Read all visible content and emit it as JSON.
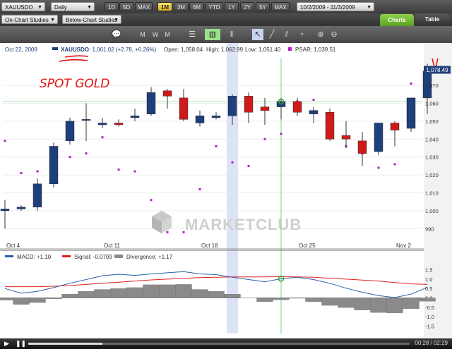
{
  "toolbar": {
    "symbol": "XAUUSDO",
    "interval": "Daily",
    "periods": [
      "1D",
      "5D",
      "MAX",
      "1M",
      "3M",
      "6M",
      "YTD",
      "1Y",
      "2Y",
      "5Y",
      "MAX"
    ],
    "active_period": "1M",
    "date_range": "10/2/2009 - 11/3/2009",
    "on_chart_studies": "On-Chart Studies",
    "below_chart_studies": "Below-Chart Studies",
    "tab_charts": "Charts",
    "tab_table": "Table"
  },
  "info_bar": {
    "date": "Oct 22, 2009",
    "symbol_label": "XAUUSDO",
    "quote": ": 1,061.02 (+2.78, +0.26%)",
    "open": "Open: 1,058.04",
    "high": "High: 1,062.99",
    "low": "Low: 1,051.40",
    "psar": "PSAR: 1,039.51"
  },
  "annotation_text": "SPOT GOLD",
  "price_tag": "1,078.49",
  "watermark": "MARKETCLUB",
  "x_labels": [
    "Oct 4",
    "Oct 11",
    "Oct 18",
    "Oct 25",
    "Nov 2"
  ],
  "indicator_legend": {
    "macd": "MACD: +1.10",
    "signal": "Signal: -0.0709",
    "divergence": "Divergence: +1.17"
  },
  "player": {
    "time": "00:28 / 02:29"
  },
  "colors": {
    "up": "#1e3f7a",
    "down": "#cc1b1b",
    "psar": "#b21cc8",
    "macd": "#2a5fa8",
    "signal": "#e02020",
    "divergence": "#8a8a8a",
    "highlight": "#dde3f6",
    "crosshair": "#7ed07e"
  },
  "chart_data": [
    {
      "type": "candlestick",
      "title": "",
      "ylim": [
        985,
        1085
      ],
      "yticks": [
        990,
        1000,
        1010,
        1020,
        1030,
        1040,
        1050,
        1060,
        1070
      ],
      "ytick_labels": [
        "990",
        "1,000",
        "1,010",
        "1,020",
        "1,030",
        "1,040",
        "1,050",
        "1,060",
        "1,070"
      ],
      "candles": [
        {
          "o": 1000,
          "h": 1006,
          "l": 990,
          "c": 1001
        },
        {
          "o": 1001,
          "h": 1003,
          "l": 1000,
          "c": 1002
        },
        {
          "o": 1002,
          "h": 1018,
          "l": 1000,
          "c": 1015
        },
        {
          "o": 1015,
          "h": 1038,
          "l": 1013,
          "c": 1036
        },
        {
          "o": 1039,
          "h": 1052,
          "l": 1037,
          "c": 1050
        },
        {
          "o": 1051,
          "h": 1060,
          "l": 1039,
          "c": 1051
        },
        {
          "o": 1048,
          "h": 1052,
          "l": 1046,
          "c": 1049
        },
        {
          "o": 1049,
          "h": 1051,
          "l": 1047,
          "c": 1048
        },
        {
          "o": 1052,
          "h": 1057,
          "l": 1050,
          "c": 1053
        },
        {
          "o": 1054,
          "h": 1069,
          "l": 1053,
          "c": 1066
        },
        {
          "o": 1067,
          "h": 1068,
          "l": 1057,
          "c": 1064
        },
        {
          "o": 1063,
          "h": 1068,
          "l": 1050,
          "c": 1051
        },
        {
          "o": 1049,
          "h": 1056,
          "l": 1047,
          "c": 1053
        },
        {
          "o": 1052,
          "h": 1055,
          "l": 1051,
          "c": 1053
        },
        {
          "o": 1053,
          "h": 1065,
          "l": 1048,
          "c": 1064
        },
        {
          "o": 1064,
          "h": 1066,
          "l": 1049,
          "c": 1055
        },
        {
          "o": 1058,
          "h": 1063,
          "l": 1048,
          "c": 1056
        },
        {
          "o": 1058,
          "h": 1063,
          "l": 1051,
          "c": 1061
        },
        {
          "o": 1061,
          "h": 1063,
          "l": 1053,
          "c": 1055
        },
        {
          "o": 1054,
          "h": 1058,
          "l": 1049,
          "c": 1056
        },
        {
          "o": 1055,
          "h": 1057,
          "l": 1039,
          "c": 1040
        },
        {
          "o": 1042,
          "h": 1050,
          "l": 1035,
          "c": 1040
        },
        {
          "o": 1039,
          "h": 1044,
          "l": 1025,
          "c": 1032
        },
        {
          "o": 1033,
          "h": 1049,
          "l": 1031,
          "c": 1049
        },
        {
          "o": 1049,
          "h": 1050,
          "l": 1036,
          "c": 1045
        },
        {
          "o": 1046,
          "h": 1063,
          "l": 1044,
          "c": 1063
        },
        {
          "o": 1063,
          "h": 1082,
          "l": 1054,
          "c": 1078
        }
      ],
      "psar": [
        1039,
        1021,
        1022,
        1016,
        1030,
        1032,
        1041,
        1023,
        1022,
        1006,
        988,
        988,
        1012,
        1036,
        1027,
        1025,
        1040,
        1043,
        1061,
        1062,
        1041,
        1036,
        1032,
        1024,
        1026,
        1071,
        1069
      ],
      "x_labels": [
        "Oct 4",
        "Oct 11",
        "Oct 18",
        "Oct 25",
        "Nov 2"
      ]
    },
    {
      "type": "macd",
      "ylim": [
        -1.9,
        1.9
      ],
      "yticks": [
        -1.5,
        -1.0,
        -0.5,
        0,
        0.5,
        1.0,
        1.5
      ],
      "ytick_labels": [
        "-1.5",
        "-1.0",
        "-0.5",
        "0.0",
        "0.5",
        "1.0",
        "1.5"
      ],
      "macd": [
        0.5,
        0.25,
        0.35,
        0.55,
        0.78,
        0.98,
        1.18,
        1.26,
        1.2,
        1.28,
        1.34,
        1.4,
        1.28,
        1.24,
        1.1,
        0.98,
        0.86,
        1.02,
        1.1,
        0.98,
        0.78,
        0.52,
        0.3,
        0.12,
        0.02,
        0.2,
        0.56
      ],
      "signal": [
        0.6,
        0.6,
        0.6,
        0.62,
        0.66,
        0.72,
        0.78,
        0.84,
        0.9,
        0.96,
        1.0,
        1.04,
        1.08,
        1.1,
        1.12,
        1.12,
        1.12,
        1.13,
        1.12,
        1.1,
        1.05,
        1.0,
        0.95,
        0.9,
        0.82,
        0.75,
        0.72
      ],
      "divergence": [
        -0.12,
        -0.35,
        -0.25,
        -0.05,
        0.2,
        0.35,
        0.45,
        0.5,
        0.55,
        0.7,
        0.7,
        0.72,
        0.45,
        0.35,
        0.2,
        0.0,
        -0.2,
        -0.1,
        -0.02,
        -0.2,
        -0.4,
        -0.52,
        -0.65,
        -0.78,
        -0.8,
        -0.58,
        -0.18
      ]
    }
  ]
}
